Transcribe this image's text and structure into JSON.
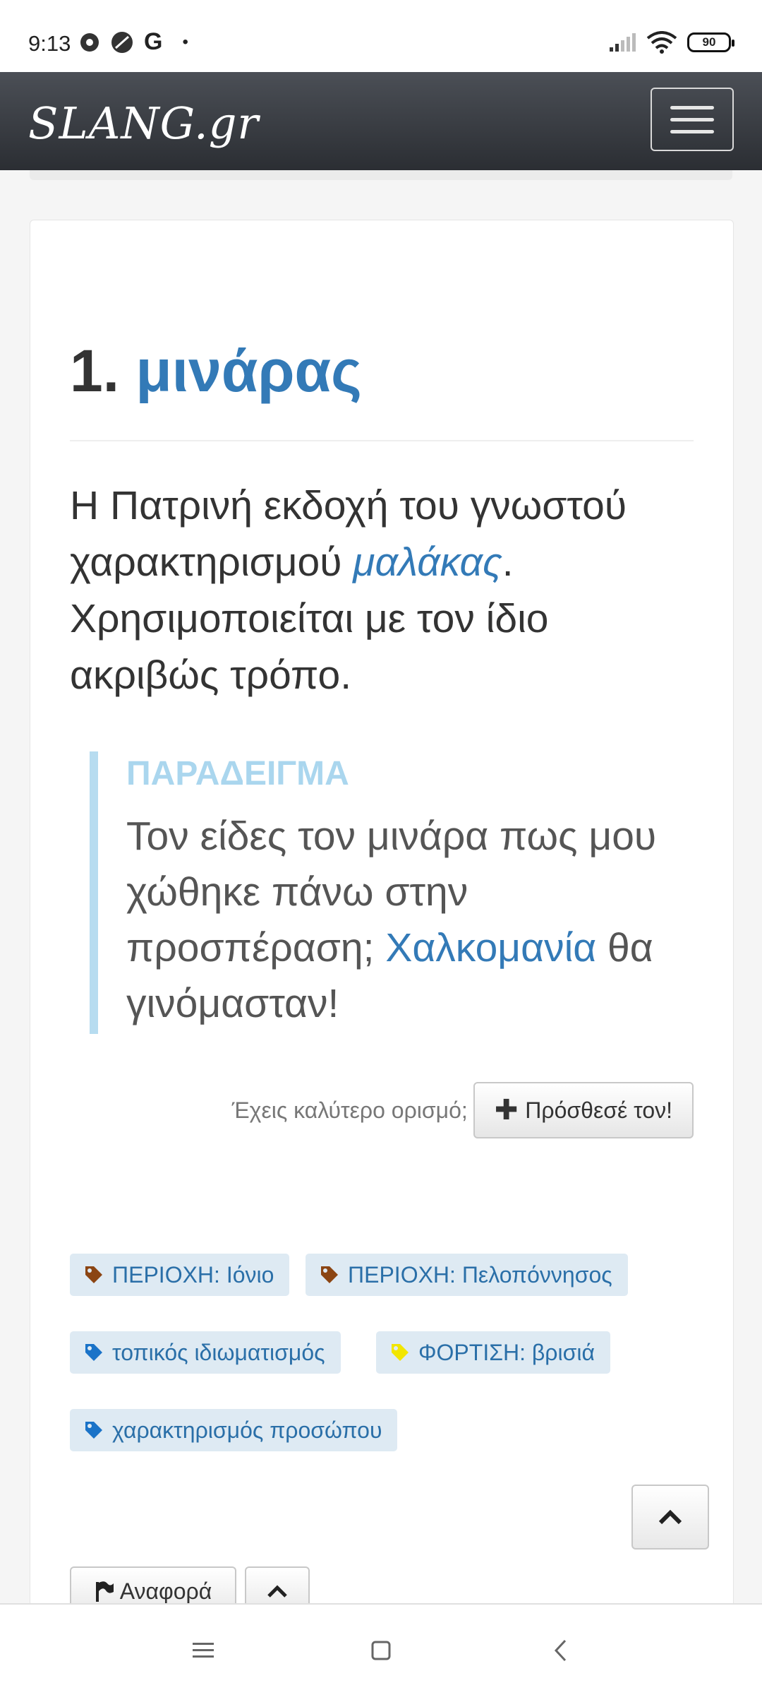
{
  "status_bar": {
    "time": "9:13",
    "battery": "90",
    "icons": [
      "chrome-icon",
      "circle-icon",
      "google-g-icon",
      "dot-icon",
      "signal-icon",
      "wifi-icon",
      "battery-icon"
    ]
  },
  "navbar": {
    "logo_text": "SLANG.gr",
    "menu_icon": "hamburger-icon"
  },
  "entry": {
    "number": "1.",
    "word": "μινάρας",
    "definition_part1": "Η Πατρινή εκδοχή του γνωστού χαρακτηρισμού ",
    "definition_link": "μαλάκας",
    "definition_part2": ". Χρησιμοποιείται με τον ίδιο ακριβώς τρόπο.",
    "example_label": "ΠΑΡΑΔΕΙΓΜΑ",
    "example_part1": "Τον είδες τον μινάρα πως μου χώθηκε πάνω στην προσπέραση; ",
    "example_link": "Χαλκομανία",
    "example_part2": " θα γινόμασταν!"
  },
  "better_definition": {
    "label": "Έχεις καλύτερο ορισμό;",
    "button": "Πρόσθεσέ τον!"
  },
  "tags": [
    {
      "label": "ΠΕΡΙΟΧΗ: Ιόνιο",
      "color": "#8b4513"
    },
    {
      "label": "ΠΕΡΙΟΧΗ: Πελοπόννησος",
      "color": "#8b4513"
    },
    {
      "label": "τοπικός ιδιωματισμός",
      "color": "#1a73c8"
    },
    {
      "label": "ΦΟΡΤΙΣΗ: βρισιά",
      "color": "#f2e600"
    },
    {
      "label": "χαρακτηρισμός προσώπου",
      "color": "#1a73c8"
    }
  ],
  "actions": {
    "report": "Αναφορά"
  },
  "colors": {
    "link": "#337ab7",
    "navbar": "#3a3d42",
    "example_border": "#b7dcf0"
  }
}
